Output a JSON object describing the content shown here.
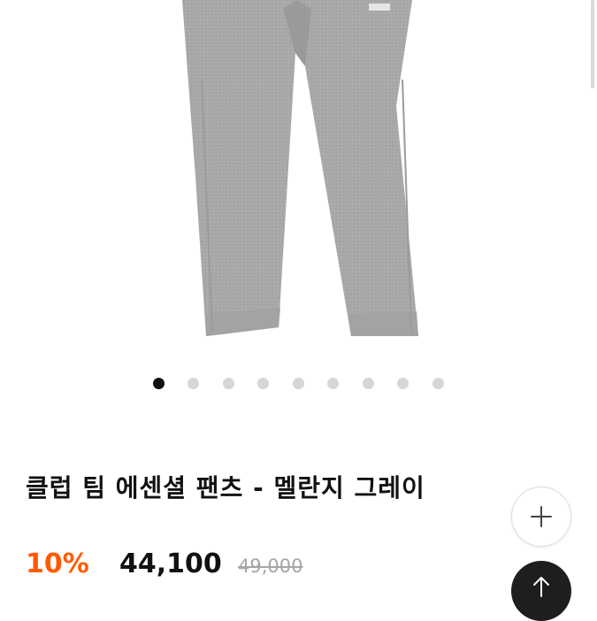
{
  "product": {
    "title": "클럽 팀 에센셜 팬츠 - 멜란지 그레이",
    "discount": "10%",
    "price": "44,100",
    "original_price": "49,000",
    "image_icon": "gray-sweatpants-image"
  },
  "gallery": {
    "active_index": 0,
    "dot_count": 9
  },
  "buttons": {
    "add_icon": "plus-icon",
    "top_icon": "arrow-up-icon"
  },
  "colors": {
    "discount": "#ff5a00",
    "dot_active": "#111111",
    "dot_inactive": "#d6d6d6",
    "pants": "#a7a7a7"
  }
}
